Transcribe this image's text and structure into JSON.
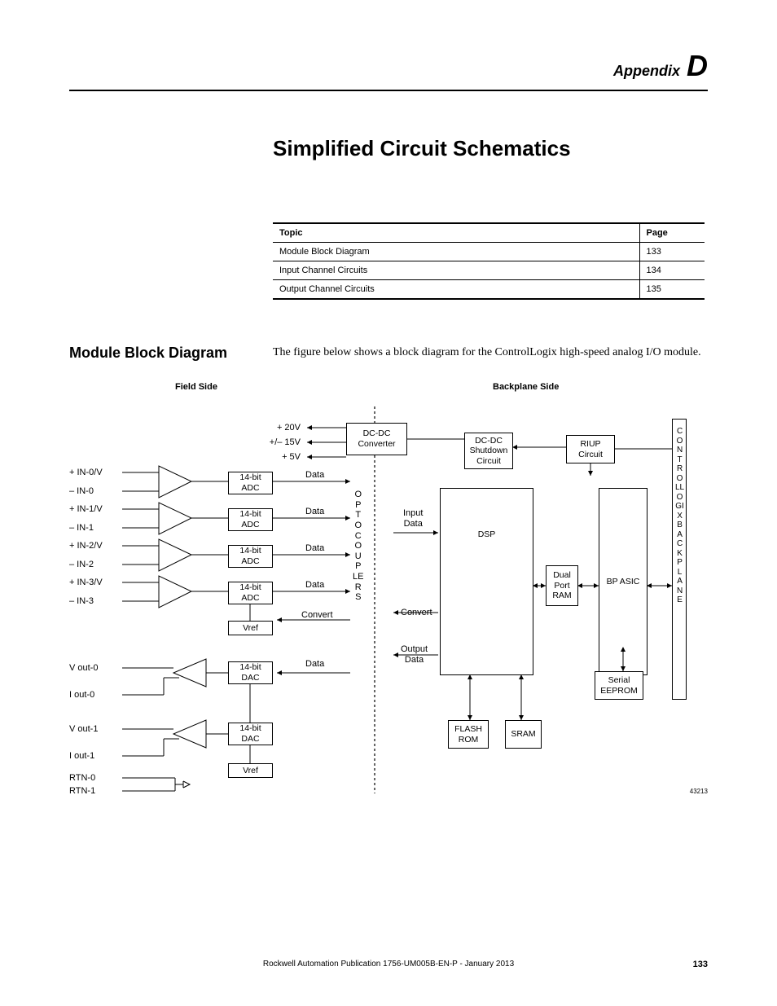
{
  "header": {
    "appendix_label": "Appendix",
    "appendix_letter": "D"
  },
  "title": "Simplified Circuit Schematics",
  "topic_table": {
    "headers": {
      "topic": "Topic",
      "page": "Page"
    },
    "rows": [
      {
        "topic": "Module Block Diagram",
        "page": "133"
      },
      {
        "topic": "Input Channel Circuits",
        "page": "134"
      },
      {
        "topic": "Output Channel Circuits",
        "page": "135"
      }
    ]
  },
  "section": {
    "heading": "Module Block Diagram",
    "body": "The figure below shows a block diagram for the ControlLogix high-speed analog I/O module."
  },
  "diagram": {
    "field_side": "Field Side",
    "backplane_side": "Backplane Side",
    "voltages": {
      "v20": "+ 20V",
      "v15": "+/– 15V",
      "v5": "+ 5V"
    },
    "inputs": {
      "in0v": "+ IN-0/V",
      "in0": "– IN-0",
      "in1v": "+ IN-1/V",
      "in1": "– IN-1",
      "in2v": "+ IN-2/V",
      "in2": "– IN-2",
      "in3v": "+ IN-3/V",
      "in3": "– IN-3"
    },
    "outputs": {
      "vout0": "V out-0",
      "iout0": "I out-0",
      "vout1": "V out-1",
      "iout1": "I out-1",
      "rtn0": "RTN-0",
      "rtn1": "RTN-1"
    },
    "adc": "14-bit\nADC",
    "dac": "14-bit\nDAC",
    "vref": "Vref",
    "data": "Data",
    "convert": "Convert",
    "dcdc": "DC-DC\nConverter",
    "dcdc_shutdown": "DC-DC\nShutdown\nCircuit",
    "riup": "RIUP\nCircuit",
    "optocouplers": "OPTOCOUPLERS",
    "input_data": "Input\nData",
    "output_data": "Output\nData",
    "dsp": "DSP",
    "dual_port_ram": "Dual\nPort\nRAM",
    "bp_asic": "BP ASIC",
    "serial_eeprom": "Serial\nEEPROM",
    "flash_rom": "FLASH\nROM",
    "sram": "SRAM",
    "backplane_label": "CONTROLLOGIX BACKPLANE",
    "fig_id": "43213"
  },
  "footer": {
    "publication": "Rockwell Automation Publication 1756-UM005B-EN-P - January 2013",
    "page": "133"
  }
}
